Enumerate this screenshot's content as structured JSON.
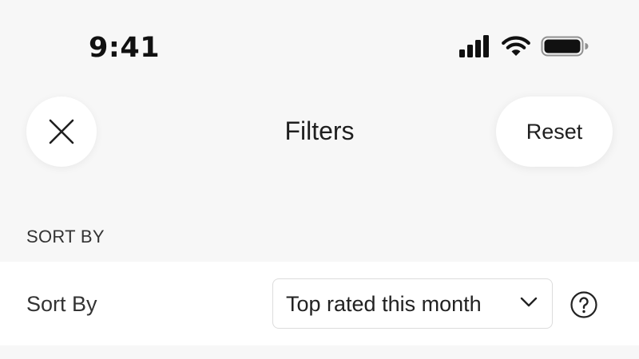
{
  "status_bar": {
    "time": "9:41",
    "icons": [
      "cellular-signal-icon",
      "wifi-icon",
      "battery-icon"
    ]
  },
  "header": {
    "close_icon": "close-icon",
    "title": "Filters",
    "reset_label": "Reset"
  },
  "section": {
    "label": "SORT BY"
  },
  "sort": {
    "label": "Sort By",
    "selected": "Top rated this month",
    "chevron_icon": "chevron-down-icon",
    "help_icon": "help-icon"
  },
  "colors": {
    "background": "#f7f7f7",
    "surface": "#ffffff",
    "text": "#222222",
    "border": "#dcdcdc"
  }
}
